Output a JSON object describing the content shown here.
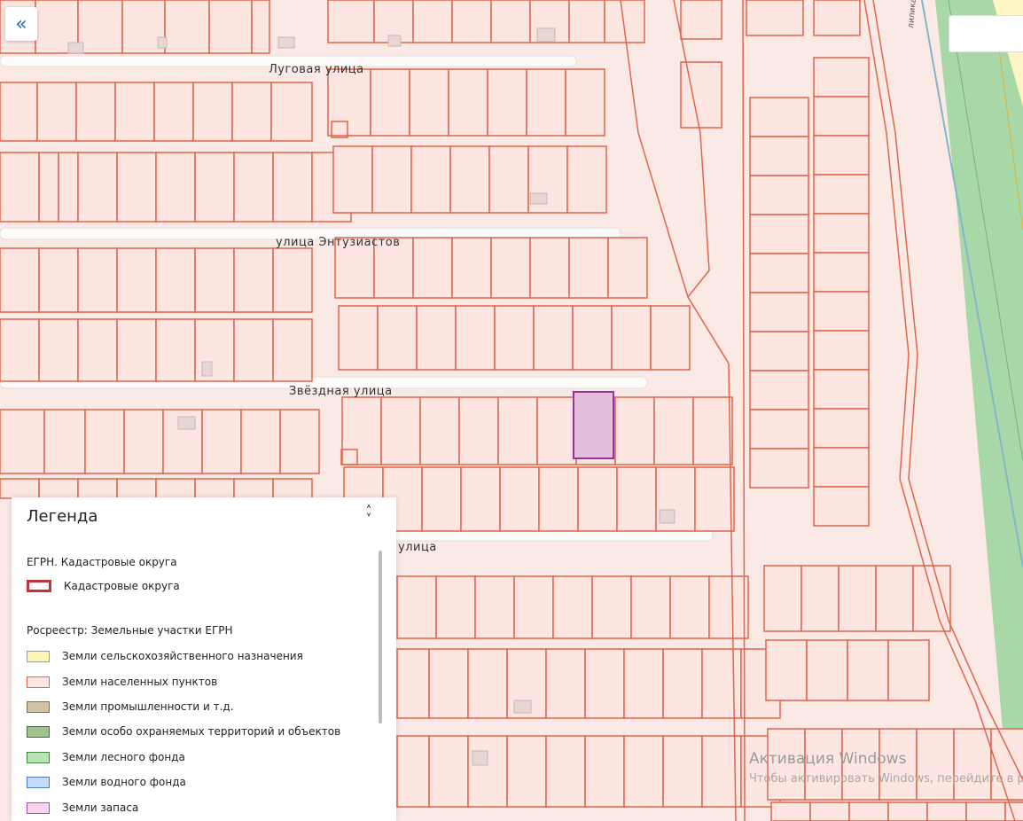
{
  "map": {
    "streets": [
      {
        "name": "Луговая улица"
      },
      {
        "name": "улица Энтузиастов"
      },
      {
        "name": "Звёздная улица"
      },
      {
        "name": "улица"
      }
    ],
    "edge_label": "лилика",
    "colors": {
      "background": "#fbe9e5",
      "parcel_fill": "#fde6e2",
      "parcel_border": "#e0654a",
      "selected_fill": "#e3bfdc",
      "selected_border": "#9b30a0",
      "forest": "#a9d8a8",
      "agri": "#fdf6c4",
      "building": "#e6d6d4"
    }
  },
  "controls": {
    "collapse_icon": "«"
  },
  "legend": {
    "title": "Легенда",
    "toggle_icon": "chevron-up-down-icon",
    "sections": [
      {
        "title": "ЕГРН. Кадастровые округа",
        "items": [
          {
            "label": "Кадастровые округа",
            "color": "#c0353a"
          }
        ]
      },
      {
        "title": "Росреестр: Земельные участки ЕГРН",
        "items": [
          {
            "label": "Земли сельскохозяйственного назначения",
            "color": "#fdf6b5"
          },
          {
            "label": "Земли населенных пунктов",
            "color": "#fde6e2"
          },
          {
            "label": "Земли промышленности и т.д.",
            "color": "#d4c2a4"
          },
          {
            "label": "Земли особо охраняемых территорий и объектов",
            "color": "#a3c290"
          },
          {
            "label": "Земли лесного фонда",
            "color": "#b9e3b6"
          },
          {
            "label": "Земли водного фонда",
            "color": "#c4dcf5"
          },
          {
            "label": "Земли запаса",
            "color": "#f6d4f0"
          }
        ]
      }
    ]
  },
  "watermark": {
    "line1": "Активация Windows",
    "line2": "Чтобы активировать Windows, перейдите в р"
  }
}
